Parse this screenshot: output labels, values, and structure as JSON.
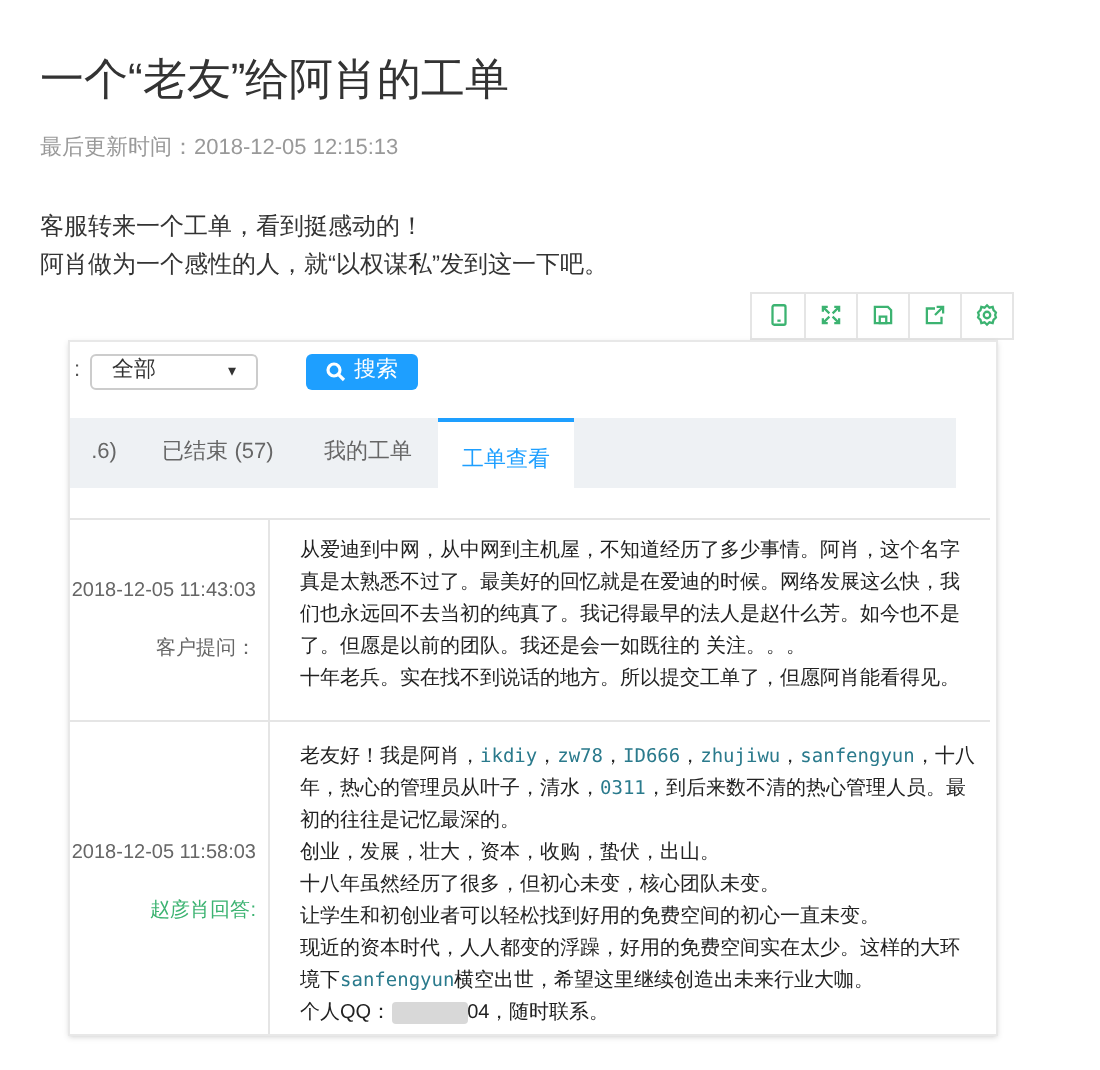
{
  "title": "一个“老友”给阿肖的工单",
  "meta": "最后更新时间：2018-12-05 12:15:13",
  "paragraphs": [
    "客服转来一个工单，看到挺感动的！",
    "阿肖做为一个感性的人，就“以权谋私”发到这一下吧。"
  ],
  "toolbar": [
    {
      "kind": "phone"
    },
    {
      "kind": "expand"
    },
    {
      "kind": "save"
    },
    {
      "kind": "share"
    },
    {
      "kind": "settings"
    }
  ],
  "screenshot": {
    "filter": {
      "label": ":",
      "select_value": "全部",
      "select_caret": "▾",
      "search_button": "搜索"
    },
    "tabs": [
      {
        "label": ".6)",
        "selected": false
      },
      {
        "label": "已结束 (57)",
        "selected": false
      },
      {
        "label": "我的工单",
        "selected": false
      },
      {
        "label": "工单查看",
        "selected": true
      }
    ],
    "rows": [
      {
        "time": "2018-12-05 11:43:03",
        "role": "客户提问：",
        "kind": "question",
        "lines": [
          [
            {
              "kind": "plain",
              "text": "从爱迪到中网，从中网到主机屋，不知道经历了多少事情。阿肖，这个名字"
            }
          ],
          [
            {
              "kind": "plain",
              "text": "真是太熟悉不过了。最美好的回忆就是在爱迪的时候。网络发展这么快，我"
            }
          ],
          [
            {
              "kind": "plain",
              "text": "们也永远回不去当初的纯真了。我记得最早的法人是赵什么芳。如今也不是"
            }
          ],
          [
            {
              "kind": "plain",
              "text": "了。但愿是以前的团队。我还是会一如既往的 关注。。。"
            }
          ],
          [
            {
              "kind": "plain",
              "text": "十年老兵。实在找不到说话的地方。所以提交工单了，但愿阿肖能看得见。"
            }
          ]
        ]
      },
      {
        "time": "2018-12-05 11:58:03",
        "role": "赵彦肖回答:",
        "kind": "answer",
        "lines": [
          [
            {
              "kind": "plain",
              "text": "老友好！我是阿肖，"
            },
            {
              "kind": "handle",
              "text": "ikdiy"
            },
            {
              "kind": "plain",
              "text": "，"
            },
            {
              "kind": "handle",
              "text": "zw78"
            },
            {
              "kind": "plain",
              "text": "，"
            },
            {
              "kind": "handle",
              "text": "ID666"
            },
            {
              "kind": "plain",
              "text": "，"
            },
            {
              "kind": "handle",
              "text": "zhujiwu"
            },
            {
              "kind": "plain",
              "text": "，"
            },
            {
              "kind": "handle",
              "text": "sanfengyun"
            },
            {
              "kind": "plain",
              "text": "，十八"
            }
          ],
          [
            {
              "kind": "plain",
              "text": "年，热心的管理员从叶子，清水，"
            },
            {
              "kind": "handle",
              "text": "0311"
            },
            {
              "kind": "plain",
              "text": "，到后来数不清的热心管理人员。最"
            }
          ],
          [
            {
              "kind": "plain",
              "text": "初的往往是记忆最深的。"
            }
          ],
          [
            {
              "kind": "plain",
              "text": "创业，发展，壮大，资本，收购，蛰伏，出山。"
            }
          ],
          [
            {
              "kind": "plain",
              "text": "十八年虽然经历了很多，但初心未变，核心团队未变。"
            }
          ],
          [
            {
              "kind": "plain",
              "text": "让学生和初创业者可以轻松找到好用的免费空间的初心一直未变。"
            }
          ],
          [
            {
              "kind": "plain",
              "text": "现近的资本时代，人人都变的浮躁，好用的免费空间实在太少。这样的大环"
            }
          ],
          [
            {
              "kind": "plain",
              "text": "境下"
            },
            {
              "kind": "handle",
              "text": "sanfengyun"
            },
            {
              "kind": "plain",
              "text": "横空出世，希望这里继续创造出未来行业大咖。"
            }
          ],
          [
            {
              "kind": "plain",
              "text": "个人QQ："
            },
            {
              "kind": "redacted"
            },
            {
              "kind": "plain",
              "text": "04，随时联系。"
            }
          ]
        ]
      }
    ]
  }
}
